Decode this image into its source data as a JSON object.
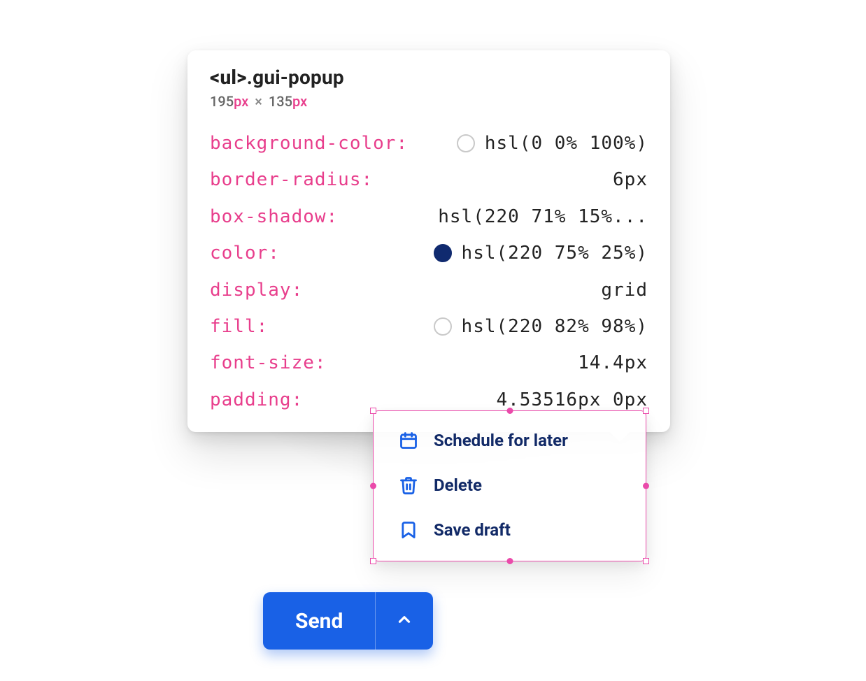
{
  "inspector": {
    "selector_tag": "<ul>",
    "selector_class": ".gui-popup",
    "width_value": "195",
    "height_value": "135",
    "px_unit": "px",
    "times_glyph": "×",
    "properties": [
      {
        "name": "background-color",
        "value": "hsl(0 0% 100%)",
        "swatch": "#ffffff",
        "swatch_style": "hollow"
      },
      {
        "name": "border-radius",
        "value": "6px"
      },
      {
        "name": "box-shadow",
        "value": "hsl(220 71% 15%..."
      },
      {
        "name": "color",
        "value": "hsl(220 75% 25%)",
        "swatch": "#102a6f",
        "swatch_style": "filled"
      },
      {
        "name": "display",
        "value": "grid"
      },
      {
        "name": "fill",
        "value": "hsl(220 82% 98%)",
        "swatch": "#f6f9fe",
        "swatch_style": "hollow"
      },
      {
        "name": "font-size",
        "value": "14.4px"
      },
      {
        "name": "padding",
        "value": "4.53516px 0px"
      }
    ]
  },
  "popup_menu": {
    "items": [
      {
        "icon": "calendar-icon",
        "label": "Schedule for later"
      },
      {
        "icon": "trash-icon",
        "label": "Delete"
      },
      {
        "icon": "bookmark-icon",
        "label": "Save draft"
      }
    ]
  },
  "send_button": {
    "label": "Send"
  },
  "colors": {
    "accent_pink": "#e83e8c",
    "accent_blue": "#1961e6",
    "text_navy": "#122a67",
    "highlight_magenta": "#ea4aaa"
  }
}
